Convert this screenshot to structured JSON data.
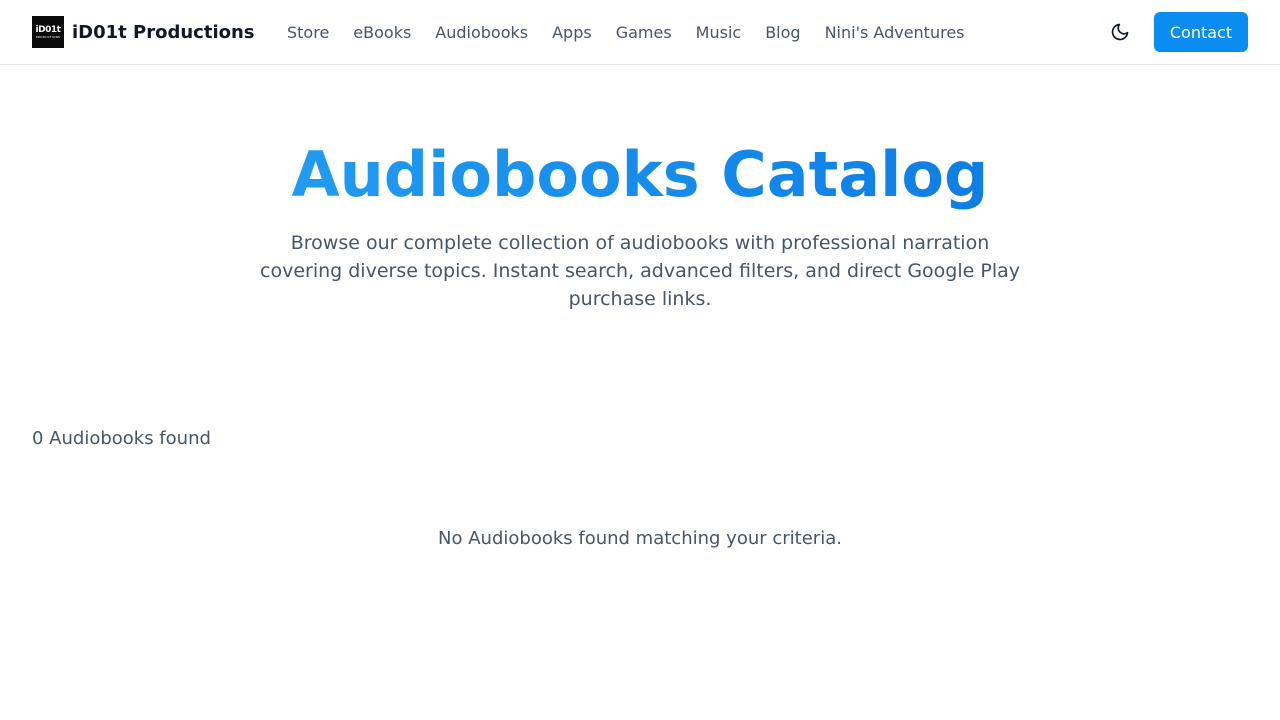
{
  "brand": {
    "logo_text": "iD01t",
    "logo_subtext": "PRODUCTIONS",
    "name": "iD01t Productions"
  },
  "nav": {
    "items": [
      {
        "label": "Store"
      },
      {
        "label": "eBooks"
      },
      {
        "label": "Audiobooks"
      },
      {
        "label": "Apps"
      },
      {
        "label": "Games"
      },
      {
        "label": "Music"
      },
      {
        "label": "Blog"
      },
      {
        "label": "Nini's Adventures"
      }
    ],
    "theme_toggle_icon": "moon-icon",
    "contact_label": "Contact"
  },
  "hero": {
    "title": "Audiobooks Catalog",
    "subtitle": "Browse our complete collection of audiobooks with professional narration covering diverse topics. Instant search, advanced filters, and direct Google Play purchase links."
  },
  "results": {
    "count_text": "0 Audiobooks found",
    "empty_message": "No Audiobooks found matching your criteria."
  },
  "colors": {
    "accent": "#0a8cf0",
    "title_gradient_start": "#2aa8f6",
    "title_gradient_end": "#0b72d8",
    "text_muted": "#475569",
    "text_dark": "#111827"
  }
}
